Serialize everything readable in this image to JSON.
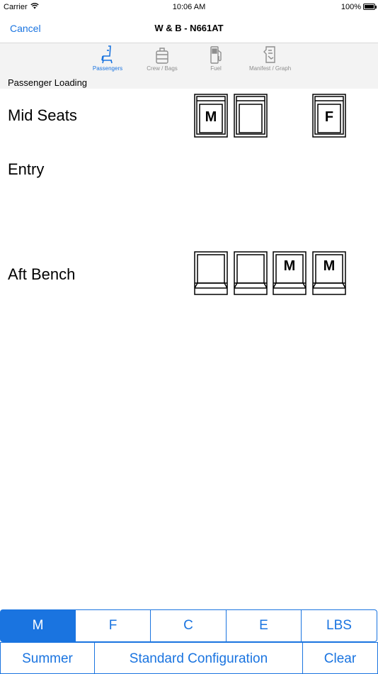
{
  "status_bar": {
    "carrier": "Carrier",
    "time": "10:06 AM",
    "battery": "100%"
  },
  "nav": {
    "cancel_label": "Cancel",
    "title": "W & B - N661AT"
  },
  "tabs": [
    {
      "label": "Passengers",
      "icon": "seat-icon",
      "active": true
    },
    {
      "label": "Crew / Bags",
      "icon": "luggage-icon",
      "active": false
    },
    {
      "label": "Fuel",
      "icon": "fuel-pump-icon",
      "active": false
    },
    {
      "label": "Manifest / Graph",
      "icon": "document-icon",
      "active": false
    }
  ],
  "section": {
    "title": "Passenger Loading"
  },
  "rows": {
    "mid_seats": {
      "label": "Mid Seats",
      "seats": [
        "M",
        "",
        "F"
      ]
    },
    "entry": {
      "label": "Entry"
    },
    "aft_bench": {
      "label": "Aft Bench",
      "seats": [
        "",
        "",
        "M",
        "M"
      ]
    }
  },
  "segments": [
    "M",
    "F",
    "C",
    "E",
    "LBS"
  ],
  "selected_segment": "M",
  "actions": {
    "summer_label": "Summer",
    "standard_label": "Standard Configuration",
    "clear_label": "Clear"
  },
  "colors": {
    "accent": "#1a74e0",
    "inactive_tab": "#8e8e8e",
    "header_bg": "#f3f3f3"
  }
}
